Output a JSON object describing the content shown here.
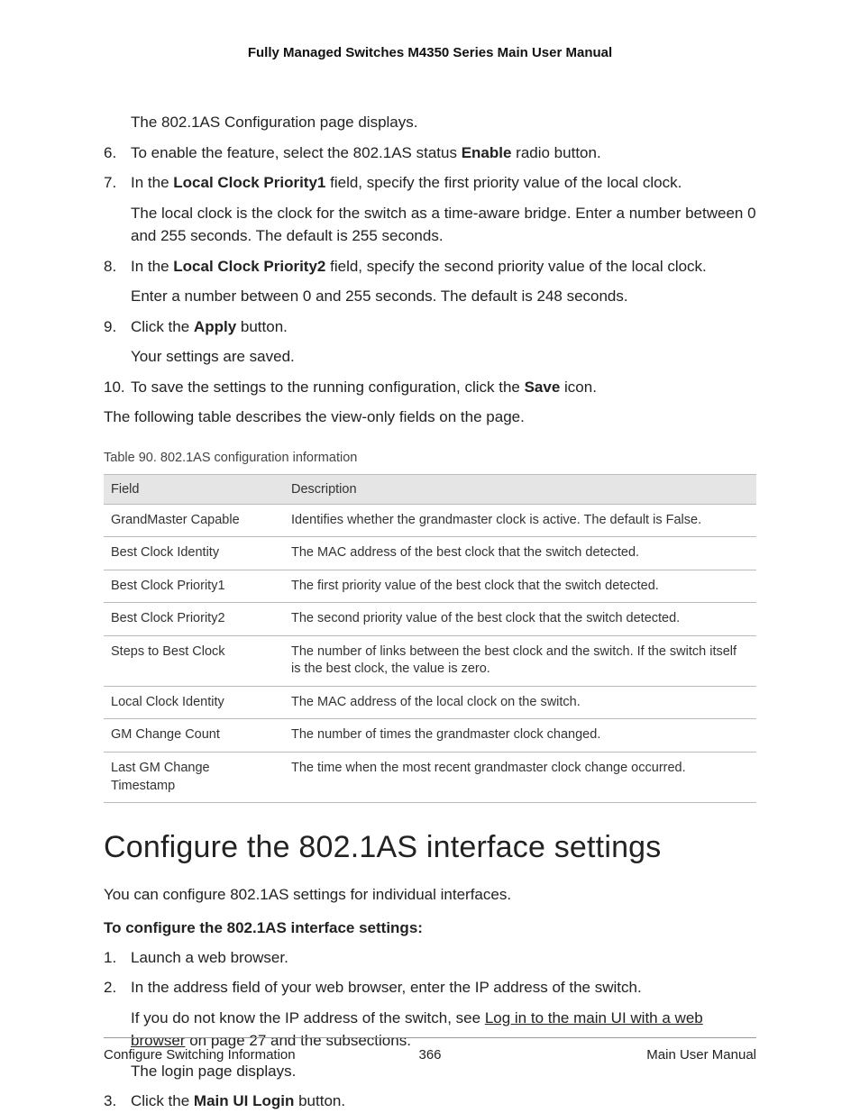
{
  "header": {
    "title": "Fully Managed Switches M4350 Series Main User Manual"
  },
  "intro_line": "The 802.1AS Configuration page displays.",
  "steps_a": [
    {
      "num": "6.",
      "parts": [
        {
          "t": "To enable the feature, select the 802.1AS status "
        },
        {
          "t": "Enable",
          "b": true
        },
        {
          "t": " radio button."
        }
      ]
    },
    {
      "num": "7.",
      "parts": [
        {
          "t": "In the "
        },
        {
          "t": "Local Clock Priority1",
          "b": true
        },
        {
          "t": " field, specify the first priority value of the local clock."
        }
      ],
      "sub": "The local clock is the clock for the switch as a time-aware bridge. Enter a number between 0 and 255 seconds. The default is 255 seconds."
    },
    {
      "num": "8.",
      "parts": [
        {
          "t": "In the "
        },
        {
          "t": "Local Clock Priority2",
          "b": true
        },
        {
          "t": " field, specify the second priority value of the local clock."
        }
      ],
      "sub": "Enter a number between 0 and 255 seconds. The default is 248 seconds."
    },
    {
      "num": "9.",
      "parts": [
        {
          "t": "Click the "
        },
        {
          "t": "Apply",
          "b": true
        },
        {
          "t": " button."
        }
      ],
      "sub": "Your settings are saved."
    },
    {
      "num": "10.",
      "parts": [
        {
          "t": "To save the settings to the running configuration, click the "
        },
        {
          "t": "Save",
          "b": true
        },
        {
          "t": " icon."
        }
      ]
    }
  ],
  "after_list": "The following table describes the view-only fields on the page.",
  "table_caption": "Table 90. 802.1AS configuration information",
  "table": {
    "headers": [
      "Field",
      "Description"
    ],
    "rows": [
      [
        "GrandMaster Capable",
        "Identifies whether the grandmaster clock is active. The default is False."
      ],
      [
        "Best Clock Identity",
        "The MAC address of the best clock that the switch detected."
      ],
      [
        "Best Clock Priority1",
        "The first priority value of the best clock that the switch detected."
      ],
      [
        "Best Clock Priority2",
        "The second priority value of the best clock that the switch detected."
      ],
      [
        "Steps to Best Clock",
        "The number of links between the best clock and the switch. If the switch itself is the best clock, the value is zero."
      ],
      [
        "Local Clock Identity",
        "The MAC address of the local clock on the switch."
      ],
      [
        "GM Change Count",
        "The number of times the grandmaster clock changed."
      ],
      [
        "Last GM Change Timestamp",
        "The time when the most recent grandmaster clock change occurred."
      ]
    ]
  },
  "h2": "Configure the 802.1AS interface settings",
  "section_intro": "You can configure 802.1AS settings for individual interfaces.",
  "subhead": "To configure the 802.1AS interface settings:",
  "steps_b": [
    {
      "num": "1.",
      "parts": [
        {
          "t": "Launch a web browser."
        }
      ]
    },
    {
      "num": "2.",
      "parts": [
        {
          "t": "In the address field of your web browser, enter the IP address of the switch."
        }
      ],
      "sub_parts": [
        {
          "t": "If you do not know the IP address of the switch, see "
        },
        {
          "t": "Log in to the main UI with a web browser",
          "link": true
        },
        {
          "t": " on page 27 and the subsections."
        }
      ],
      "sub2": "The login page displays."
    },
    {
      "num": "3.",
      "parts": [
        {
          "t": "Click the "
        },
        {
          "t": "Main UI Login",
          "b": true
        },
        {
          "t": " button."
        }
      ]
    }
  ],
  "footer": {
    "left": "Configure Switching Information",
    "center": "366",
    "right": "Main User Manual"
  }
}
